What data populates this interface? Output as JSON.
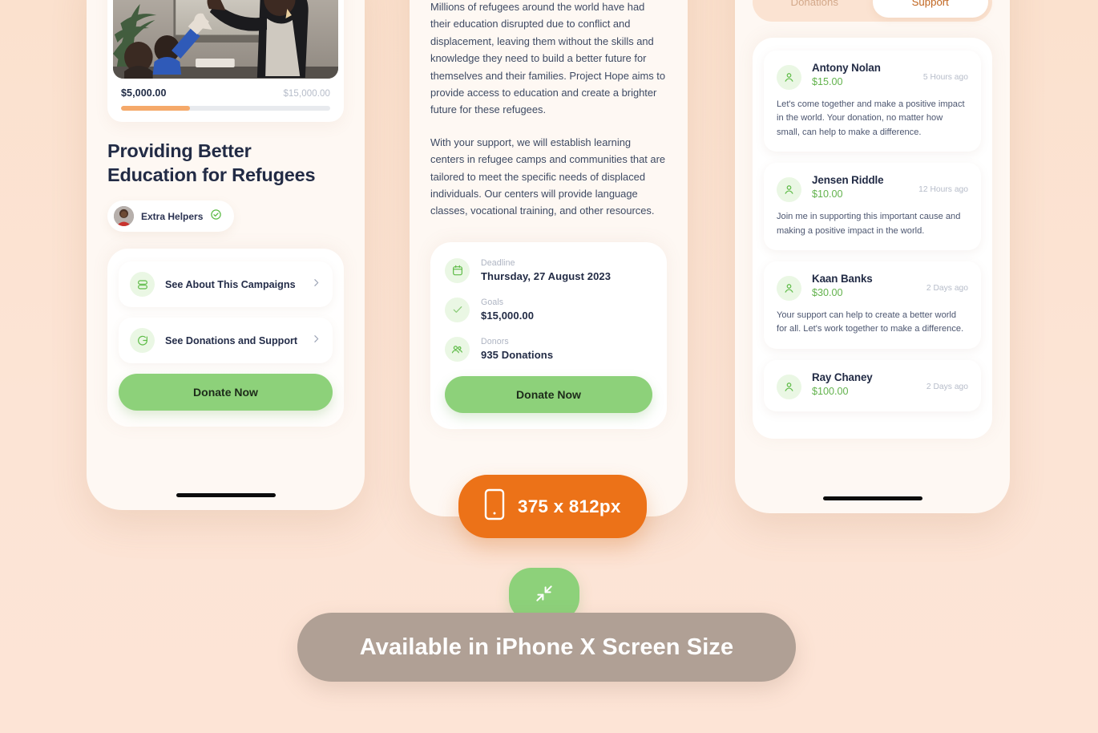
{
  "page": {
    "background_color": "#FCE3D3",
    "accent_green": "#8DD17A",
    "accent_orange": "#EC7218"
  },
  "phone1": {
    "campaign": {
      "raised": "$5,000.00",
      "goal": "$15,000.00",
      "progress_percent": 33,
      "title": "Providing Better Education for Refugees",
      "organizer": "Extra Helpers",
      "verified": true,
      "photo_alt": "woman high-fiving a child in a classroom"
    },
    "rows": [
      {
        "icon": "list-icon",
        "label": "See About This Campaigns"
      },
      {
        "icon": "chat-bubble-icon",
        "label": "See Donations and Support"
      }
    ],
    "donate_label": "Donate Now"
  },
  "phone2": {
    "paragraphs": [
      "Millions of refugees around the world have had their education disrupted due to conflict and displacement, leaving them without the skills and knowledge they need to build a better future for themselves and their families. Project Hope aims to provide access to education and create a brighter future for these refugees.",
      "With your support, we will establish learning centers in refugee camps and communities that are tailored to meet the specific needs of displaced individuals. Our centers will provide language classes, vocational training, and other resources."
    ],
    "info": [
      {
        "icon": "calendar-icon",
        "key": "Deadline",
        "value": "Thursday, 27 August 2023"
      },
      {
        "icon": "check-icon",
        "key": "Goals",
        "value": "$15,000.00"
      },
      {
        "icon": "donors-icon",
        "key": "Donors",
        "value": "935 Donations"
      }
    ],
    "donate_label": "Donate Now"
  },
  "phone3": {
    "tabs": [
      {
        "label": "Donations",
        "active": false
      },
      {
        "label": "Support",
        "active": true
      }
    ],
    "donations": [
      {
        "name": "Antony Nolan",
        "amount": "$15.00",
        "time": "5 Hours ago",
        "message": "Let's come together and make a positive impact in the world. Your donation, no matter how small, can help to make a difference."
      },
      {
        "name": "Jensen Riddle",
        "amount": "$10.00",
        "time": "12 Hours ago",
        "message": "Join me in supporting this important cause and making a positive impact in the world."
      },
      {
        "name": "Kaan Banks",
        "amount": "$30.00",
        "time": "2 Days ago",
        "message": "Your support can help to create a better world for all. Let's work together to make a difference."
      },
      {
        "name": "Ray Chaney",
        "amount": "$100.00",
        "time": "2 Days ago",
        "message": ""
      }
    ]
  },
  "size_badge": {
    "icon": "mobile-phone-icon",
    "label": "375 x 812px"
  },
  "bottom_banner": {
    "fab_icon": "collapse-arrows-icon",
    "label": "Available in iPhone X Screen Size"
  }
}
